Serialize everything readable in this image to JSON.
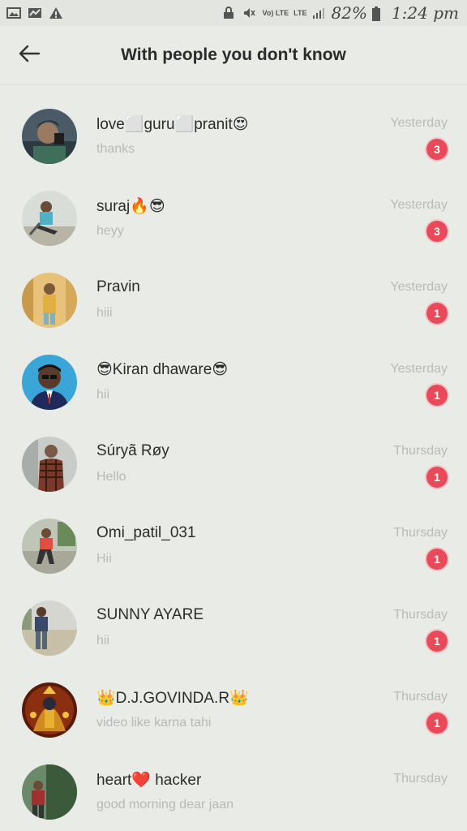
{
  "status_bar": {
    "signal_text": "Vo) LTE",
    "lte_label": "LTE",
    "battery": "82%",
    "time": "1:24 pm"
  },
  "header": {
    "title": "With people you don't know"
  },
  "conversations": [
    {
      "name": "love⬜guru⬜pranit😍",
      "message": "thanks",
      "time": "Yesterday",
      "unread": "3"
    },
    {
      "name": "suraj🔥😎",
      "message": "heyy",
      "time": "Yesterday",
      "unread": "3"
    },
    {
      "name": "Pravin",
      "message": "hiii",
      "time": "Yesterday",
      "unread": "1"
    },
    {
      "name": "😎Kiran dhaware😎",
      "message": "hii",
      "time": "Yesterday",
      "unread": "1"
    },
    {
      "name": "Súryã Røy",
      "message": "Hello",
      "time": "Thursday",
      "unread": "1"
    },
    {
      "name": "Omi_patil_031",
      "message": "Hii",
      "time": "Thursday",
      "unread": "1"
    },
    {
      "name": "SUNNY AYARE",
      "message": "hii",
      "time": "Thursday",
      "unread": "1"
    },
    {
      "name": "👑D.J.GOVINDA.R👑",
      "message": "video like karna tahi",
      "time": "Thursday",
      "unread": "1"
    },
    {
      "name": "heart❤️ hacker",
      "message": "good morning dear jaan",
      "time": "Thursday",
      "unread": ""
    }
  ],
  "colors": {
    "background": "#e9ebe7",
    "badge": "#e84a5a",
    "muted_text": "#b9bbb7"
  }
}
